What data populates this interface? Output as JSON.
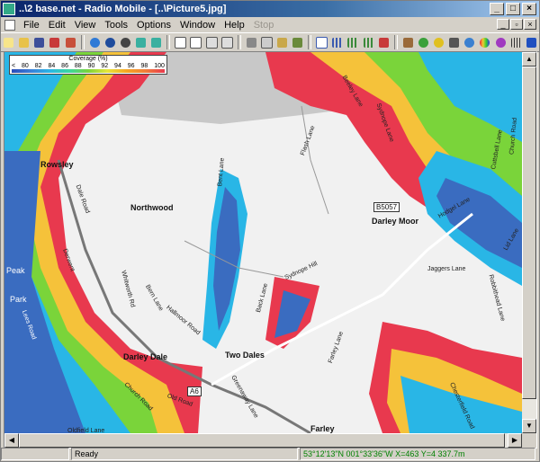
{
  "window": {
    "title": "..\\2 base.net - Radio Mobile - [..\\Picture5.jpg]"
  },
  "menu": [
    "File",
    "Edit",
    "View",
    "Tools",
    "Options",
    "Window",
    "Help",
    "Stop"
  ],
  "legend": {
    "title": "Coverage (%)",
    "ticks": [
      "<",
      "80",
      "82",
      "84",
      "86",
      "88",
      "90",
      "92",
      "94",
      "96",
      "98",
      "100"
    ]
  },
  "places": {
    "rowsley": "Rowsley",
    "northwood": "Northwood",
    "darley_moor": "Darley Moor",
    "darley_dale": "Darley Dale",
    "two_dales": "Two Dales",
    "farley": "Farley",
    "peak_park": "Peak",
    "park": "Park",
    "lees_road": "Lees Road",
    "b5057": "B5057",
    "a6": "A6"
  },
  "roads": {
    "beeley_lane": "Beeley Lane",
    "sydnope_lane": "Sydnope Lane",
    "flash_lane": "Flash Lane",
    "bent_lane": "Bent Lane",
    "dale_road": "Dale Road",
    "derwent": "Derwent",
    "whitworth": "Whitworth Rd",
    "bern_lane": "Bern Lane",
    "hallmoor": "Hallmoor Road",
    "back_lane": "Back Lane",
    "sydnope_hill": "Sydnope Hill",
    "jaggers": "Jaggers Lane",
    "hodgel": "Hodgel Lane",
    "farley_lane": "Farley Lane",
    "greenaway": "Greenaway Lane",
    "church_road": "Church Road",
    "old_road": "Old Road",
    "oldfield": "Oldfield Lane",
    "chesterfield": "Chesterfield Road",
    "lid_lane": "Lid Lane",
    "cuttsbell": "Cuttsbell Lane",
    "rabbitheads": "Robbithead Lane",
    "church_road2": "Church Road"
  },
  "status": {
    "ready": "Ready",
    "coords": "53°12'13\"N 001°33'36\"W  X=463 Y=4 337.7m"
  },
  "colors": {
    "accent": "#0a246a",
    "coverage_low": "#2b4bb8",
    "coverage_high": "#e8394e"
  }
}
